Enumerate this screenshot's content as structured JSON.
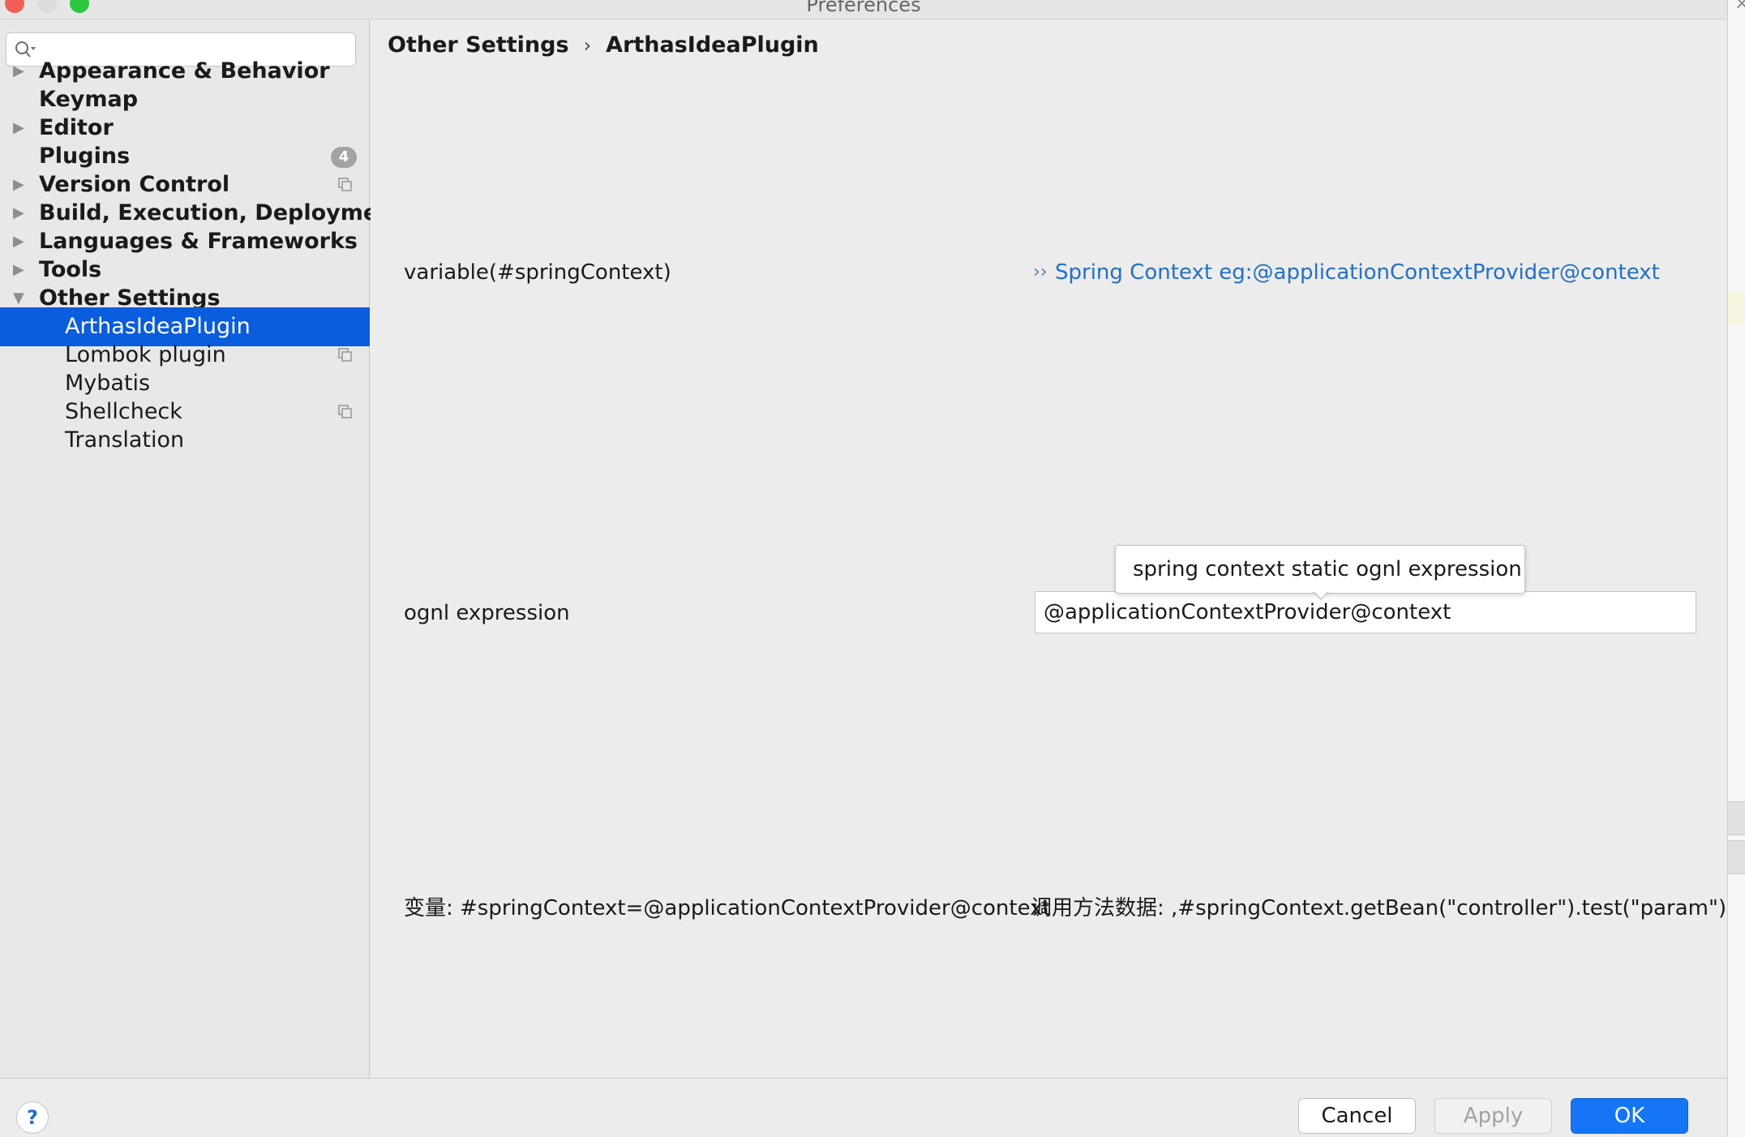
{
  "window": {
    "title": "Preferences"
  },
  "search": {
    "placeholder": ""
  },
  "sidebar": {
    "items": [
      {
        "label": "Appearance & Behavior",
        "expandable": true,
        "expanded": false
      },
      {
        "label": "Keymap",
        "expandable": false
      },
      {
        "label": "Editor",
        "expandable": true,
        "expanded": false
      },
      {
        "label": "Plugins",
        "expandable": false,
        "badge": "4"
      },
      {
        "label": "Version Control",
        "expandable": true,
        "expanded": false,
        "icon": "copy-icon"
      },
      {
        "label": "Build, Execution, Deployment",
        "expandable": true,
        "expanded": false
      },
      {
        "label": "Languages & Frameworks",
        "expandable": true,
        "expanded": false
      },
      {
        "label": "Tools",
        "expandable": true,
        "expanded": false
      },
      {
        "label": "Other Settings",
        "expandable": true,
        "expanded": true
      }
    ],
    "children": [
      {
        "label": "ArthasIdeaPlugin",
        "selected": true
      },
      {
        "label": "Lombok plugin",
        "icon": "copy-icon"
      },
      {
        "label": "Mybatis"
      },
      {
        "label": "Shellcheck",
        "icon": "copy-icon"
      },
      {
        "label": "Translation"
      }
    ]
  },
  "breadcrumb": {
    "parent": "Other Settings",
    "separator": "›",
    "current": "ArthasIdeaPlugin"
  },
  "settings": {
    "variable_label": "variable(#springContext)",
    "variable_link": "Spring Context eg:@applicationContextProvider@context",
    "ognl_label": "ognl expression",
    "ognl_value": "@applicationContextProvider@context",
    "ognl_tooltip": "spring context static ognl expression",
    "hint_variable": "变量: #springContext=@applicationContextProvider@context",
    "hint_call": "调用方法数据: ,#springContext.getBean(\"controller\").test(\"param\")"
  },
  "buttons": {
    "help": "?",
    "cancel": "Cancel",
    "apply": "Apply",
    "ok": "OK"
  },
  "colors": {
    "accent": "#1576f5",
    "selection": "#0a5ddc",
    "link": "#2470c4"
  }
}
